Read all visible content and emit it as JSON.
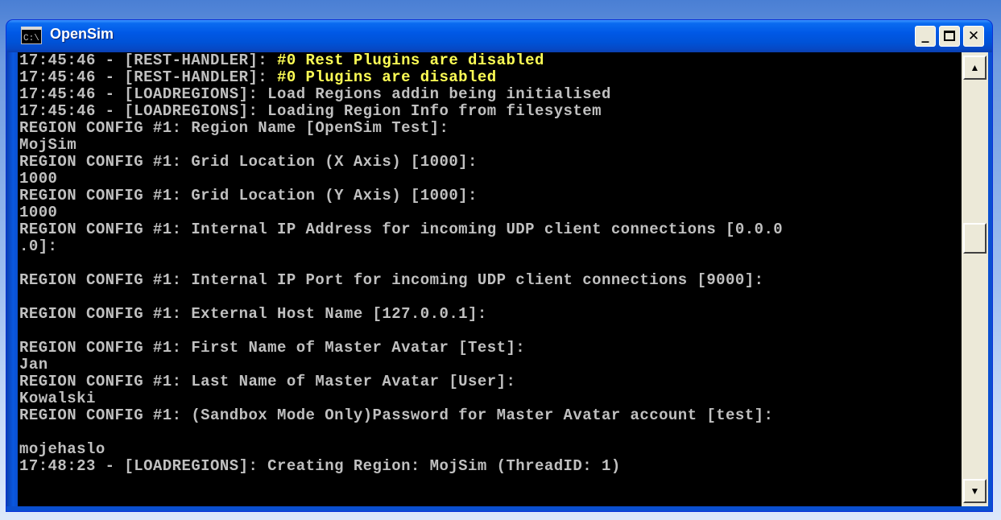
{
  "window": {
    "title": "OpenSim",
    "icon_text": "C:\\",
    "minimize_glyph": "_",
    "close_glyph": "✕"
  },
  "scrollbar": {
    "up_glyph": "▲",
    "down_glyph": "▼"
  },
  "console": {
    "lines": [
      {
        "prefix": "17:45:46 - [REST-HANDLER]: ",
        "highlight": "#0 Rest Plugins are disabled"
      },
      {
        "prefix": "17:45:46 - [REST-HANDLER]: ",
        "highlight": "#0 Plugins are disabled"
      },
      {
        "prefix": "17:45:46 - [LOADREGIONS]: Load Regions addin being initialised",
        "highlight": ""
      },
      {
        "prefix": "17:45:46 - [LOADREGIONS]: Loading Region Info from filesystem",
        "highlight": ""
      },
      {
        "prefix": "REGION CONFIG #1: Region Name [OpenSim Test]:",
        "highlight": ""
      },
      {
        "prefix": "MojSim",
        "highlight": ""
      },
      {
        "prefix": "REGION CONFIG #1: Grid Location (X Axis) [1000]:",
        "highlight": ""
      },
      {
        "prefix": "1000",
        "highlight": ""
      },
      {
        "prefix": "REGION CONFIG #1: Grid Location (Y Axis) [1000]:",
        "highlight": ""
      },
      {
        "prefix": "1000",
        "highlight": ""
      },
      {
        "prefix": "REGION CONFIG #1: Internal IP Address for incoming UDP client connections [0.0.0",
        "highlight": ""
      },
      {
        "prefix": ".0]:",
        "highlight": ""
      },
      {
        "prefix": "",
        "highlight": ""
      },
      {
        "prefix": "REGION CONFIG #1: Internal IP Port for incoming UDP client connections [9000]:",
        "highlight": ""
      },
      {
        "prefix": "",
        "highlight": ""
      },
      {
        "prefix": "REGION CONFIG #1: External Host Name [127.0.0.1]:",
        "highlight": ""
      },
      {
        "prefix": "",
        "highlight": ""
      },
      {
        "prefix": "REGION CONFIG #1: First Name of Master Avatar [Test]:",
        "highlight": ""
      },
      {
        "prefix": "Jan",
        "highlight": ""
      },
      {
        "prefix": "REGION CONFIG #1: Last Name of Master Avatar [User]:",
        "highlight": ""
      },
      {
        "prefix": "Kowalski",
        "highlight": ""
      },
      {
        "prefix": "REGION CONFIG #1: (Sandbox Mode Only)Password for Master Avatar account [test]:",
        "highlight": ""
      },
      {
        "prefix": "",
        "highlight": ""
      },
      {
        "prefix": "mojehaslo",
        "highlight": ""
      },
      {
        "prefix": "17:48:23 - [LOADREGIONS]: Creating Region: MojSim (ThreadID: 1)",
        "highlight": ""
      }
    ]
  },
  "colors": {
    "console_text": "#c0c0c0",
    "highlight_text": "#ffff55",
    "console_background": "#000000",
    "title_bar": "#0058e6"
  }
}
